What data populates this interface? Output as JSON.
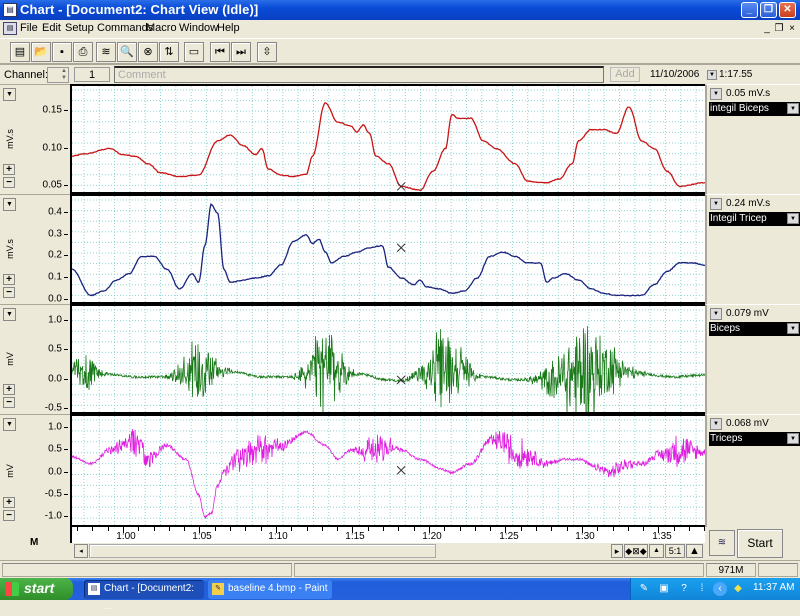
{
  "window": {
    "title": "Chart - [Document2: Chart View (Idle)]",
    "controls": {
      "minimize": "_",
      "restore": "❐",
      "close": "✕"
    },
    "mdi_controls": {
      "minimize": "_",
      "restore": "❐",
      "close": "×"
    }
  },
  "menu": [
    "File",
    "Edit",
    "Setup",
    "Commands",
    "Macro",
    "Window",
    "Help"
  ],
  "toolbar": {
    "buttons": [
      {
        "name": "chart-view-icon",
        "glyph": "▤"
      },
      {
        "name": "open-folder-icon",
        "glyph": "📂"
      },
      {
        "name": "save-icon",
        "glyph": "▪"
      },
      {
        "name": "print-icon",
        "glyph": "⎙"
      },
      {
        "name": "channel-settings-icon",
        "glyph": "≋"
      },
      {
        "name": "zoom-view-icon",
        "glyph": "🔍"
      },
      {
        "name": "marker-icon",
        "glyph": "⊗"
      },
      {
        "name": "sort-icon",
        "glyph": "⇅"
      },
      {
        "name": "display-icon",
        "glyph": "▭"
      },
      {
        "name": "skip-start-icon",
        "glyph": "⏮"
      },
      {
        "name": "skip-end-icon",
        "glyph": "⏭"
      },
      {
        "name": "channel-order-icon",
        "glyph": "⇳"
      }
    ]
  },
  "channelbar": {
    "label": "Channel:",
    "channel_value": "",
    "comment_number": "1",
    "comment_placeholder": "Comment",
    "add_label": "Add",
    "date": "11/10/2006",
    "time": "1:17.55"
  },
  "chart_data": [
    {
      "type": "line",
      "title": "integil Biceps",
      "ylabel": "mV.s",
      "range_readout": "0.05 mV.s",
      "color": "#c81414",
      "ylim": [
        0.04,
        0.18
      ],
      "yticks": [
        0.05,
        0.1,
        0.15
      ],
      "ytick_labels": [
        "0.05",
        "0.10",
        "0.15"
      ],
      "x": [
        0.0,
        0.02,
        0.06,
        0.08,
        0.1,
        0.12,
        0.14,
        0.17,
        0.2,
        0.23,
        0.25,
        0.27,
        0.29,
        0.3,
        0.31,
        0.33,
        0.35,
        0.37,
        0.38,
        0.4,
        0.42,
        0.44,
        0.45,
        0.46,
        0.47,
        0.48,
        0.5,
        0.52,
        0.55,
        0.57,
        0.59,
        0.6,
        0.61,
        0.63,
        0.65,
        0.67,
        0.7,
        0.72,
        0.74,
        0.75,
        0.77,
        0.79,
        0.8,
        0.82,
        0.84,
        0.86,
        0.88,
        0.9,
        0.92,
        0.94,
        0.96,
        1.0
      ],
      "y": [
        0.09,
        0.093,
        0.1,
        0.092,
        0.09,
        0.08,
        0.068,
        0.063,
        0.065,
        0.11,
        0.118,
        0.104,
        0.092,
        0.1,
        0.073,
        0.065,
        0.063,
        0.066,
        0.09,
        0.16,
        0.135,
        0.13,
        0.122,
        0.131,
        0.12,
        0.09,
        0.08,
        0.05,
        0.045,
        0.07,
        0.1,
        0.145,
        0.14,
        0.14,
        0.11,
        0.1,
        0.08,
        0.057,
        0.055,
        0.055,
        0.06,
        0.08,
        0.11,
        0.125,
        0.125,
        0.12,
        0.155,
        0.11,
        0.1,
        0.07,
        0.05,
        0.055
      ],
      "marker_x": 0.52,
      "marker_y": 0.05
    },
    {
      "type": "line",
      "title": "Integil Tricep",
      "ylabel": "mV.s",
      "range_readout": "0.24 mV.s",
      "color": "#1a237e",
      "ylim": [
        -0.02,
        0.47
      ],
      "yticks": [
        0.0,
        0.1,
        0.2,
        0.3,
        0.4
      ],
      "ytick_labels": [
        "0.0",
        "0.1",
        "0.2",
        "0.3",
        "0.4"
      ],
      "x": [
        0.0,
        0.03,
        0.05,
        0.07,
        0.09,
        0.11,
        0.13,
        0.15,
        0.17,
        0.19,
        0.2,
        0.21,
        0.22,
        0.23,
        0.24,
        0.25,
        0.27,
        0.29,
        0.31,
        0.33,
        0.35,
        0.37,
        0.38,
        0.39,
        0.4,
        0.41,
        0.43,
        0.45,
        0.47,
        0.49,
        0.5,
        0.52,
        0.54,
        0.55,
        0.56,
        0.58,
        0.6,
        0.62,
        0.64,
        0.66,
        0.68,
        0.7,
        0.72,
        0.74,
        0.75,
        0.76,
        0.78,
        0.8,
        0.82,
        0.84,
        0.86,
        0.88,
        0.9,
        0.92,
        0.94,
        0.96,
        0.98,
        1.0
      ],
      "y": [
        0.14,
        0.02,
        0.04,
        0.09,
        0.12,
        0.2,
        0.2,
        0.14,
        0.05,
        0.12,
        0.08,
        0.25,
        0.44,
        0.4,
        0.14,
        0.08,
        0.09,
        0.1,
        0.11,
        0.16,
        0.27,
        0.3,
        0.26,
        0.28,
        0.22,
        0.17,
        0.2,
        0.22,
        0.24,
        0.25,
        0.15,
        0.1,
        0.07,
        0.09,
        0.06,
        0.05,
        0.03,
        0.04,
        0.1,
        0.2,
        0.22,
        0.2,
        0.17,
        0.17,
        0.08,
        0.1,
        0.12,
        0.09,
        0.05,
        0.03,
        0.02,
        0.02,
        0.02,
        0.07,
        0.13,
        0.17,
        0.17,
        0.16
      ],
      "marker_x": 0.52,
      "marker_y": 0.24
    },
    {
      "type": "line",
      "title": "Biceps",
      "ylabel": "mV",
      "range_readout": "0.079 mV",
      "color": "#1a7a1a",
      "ylim": [
        -0.58,
        1.22
      ],
      "yticks": [
        -0.5,
        0.0,
        0.5,
        1.0
      ],
      "ytick_labels": [
        "-0.5",
        "0.0",
        "0.5",
        "1.0"
      ],
      "baseline_x": [
        0.0,
        0.05,
        0.1,
        0.15,
        0.2,
        0.25,
        0.3,
        0.35,
        0.4,
        0.45,
        0.5,
        0.52,
        0.55,
        0.6,
        0.65,
        0.7,
        0.75,
        0.8,
        0.85,
        0.9,
        0.95,
        1.0
      ],
      "baseline_y": [
        0.2,
        0.1,
        0.05,
        0.05,
        0.2,
        0.15,
        0.05,
        0.05,
        0.2,
        0.1,
        0.0,
        -0.02,
        0.1,
        0.2,
        0.05,
        0.0,
        0.0,
        0.1,
        0.2,
        0.1,
        0.05,
        0.08
      ],
      "bursts": [
        {
          "center": 0.02,
          "width": 0.03,
          "amplitude": 0.35
        },
        {
          "center": 0.2,
          "width": 0.045,
          "amplitude": 0.65
        },
        {
          "center": 0.4,
          "width": 0.045,
          "amplitude": 0.8
        },
        {
          "center": 0.59,
          "width": 0.05,
          "amplitude": 0.75
        },
        {
          "center": 0.81,
          "width": 0.08,
          "amplitude": 0.9
        }
      ],
      "marker_x": 0.52,
      "marker_y": 0.0
    },
    {
      "type": "line",
      "title": "Triceps",
      "ylabel": "mV",
      "range_readout": "0.068 mV",
      "color": "#e020e0",
      "ylim": [
        -1.22,
        1.22
      ],
      "yticks": [
        -1.0,
        -0.5,
        0.0,
        0.5,
        1.0
      ],
      "ytick_labels": [
        "-1.0",
        "-0.5",
        "0.0",
        "0.5",
        "1.0"
      ],
      "baseline_x": [
        0.0,
        0.03,
        0.06,
        0.08,
        0.1,
        0.12,
        0.15,
        0.18,
        0.2,
        0.21,
        0.22,
        0.23,
        0.24,
        0.26,
        0.28,
        0.3,
        0.33,
        0.37,
        0.4,
        0.42,
        0.44,
        0.47,
        0.5,
        0.52,
        0.55,
        0.58,
        0.6,
        0.63,
        0.66,
        0.68,
        0.7,
        0.72,
        0.75,
        0.78,
        0.8,
        0.83,
        0.85,
        0.88,
        0.9,
        0.93,
        0.96,
        1.0
      ],
      "baseline_y": [
        0.35,
        0.2,
        0.5,
        0.6,
        0.7,
        0.3,
        0.6,
        0.3,
        -0.5,
        -1.0,
        -0.9,
        -0.3,
        0.0,
        0.3,
        0.4,
        0.5,
        0.6,
        0.9,
        0.6,
        0.3,
        0.5,
        0.5,
        0.6,
        0.5,
        0.3,
        0.1,
        0.0,
        0.2,
        0.7,
        0.7,
        0.4,
        0.4,
        0.2,
        0.3,
        0.3,
        0.1,
        0.0,
        0.2,
        0.2,
        0.4,
        0.5,
        0.45
      ],
      "bursts": [
        {
          "center": 0.1,
          "width": 0.05,
          "amplitude": 0.3
        },
        {
          "center": 0.29,
          "width": 0.06,
          "amplitude": 0.4
        },
        {
          "center": 0.48,
          "width": 0.035,
          "amplitude": 0.45
        },
        {
          "center": 0.7,
          "width": 0.06,
          "amplitude": 0.35
        },
        {
          "center": 0.86,
          "width": 0.05,
          "amplitude": 0.15
        },
        {
          "center": 0.96,
          "width": 0.05,
          "amplitude": 0.35
        }
      ],
      "marker_x": 0.52,
      "marker_y": 0.05
    }
  ],
  "time_axis": {
    "labels": [
      "1:00",
      "1:05",
      "1:10",
      "1:15",
      "1:20",
      "1:25",
      "1:30",
      "1:35"
    ],
    "label_positions": [
      0.082,
      0.232,
      0.382,
      0.532,
      0.682,
      0.832,
      0.982,
      1.132
    ],
    "start_min": 0.95,
    "end_min": 1.37
  },
  "bottom_controls": {
    "scroll_left": "◂",
    "scroll_right": "▸",
    "fit": "◆⊠◆",
    "compress_small": "▲",
    "ratio": "5:1",
    "compress_large": "▲",
    "start_label": "Start"
  },
  "statusbar": {
    "memory": "971M"
  },
  "taskbar": {
    "start_label": "start",
    "tasks": [
      {
        "label": "Chart - [Document2: ...",
        "active": true
      },
      {
        "label": "baseline 4.bmp - Paint",
        "active": false
      }
    ],
    "clock": "11:37 AM"
  }
}
